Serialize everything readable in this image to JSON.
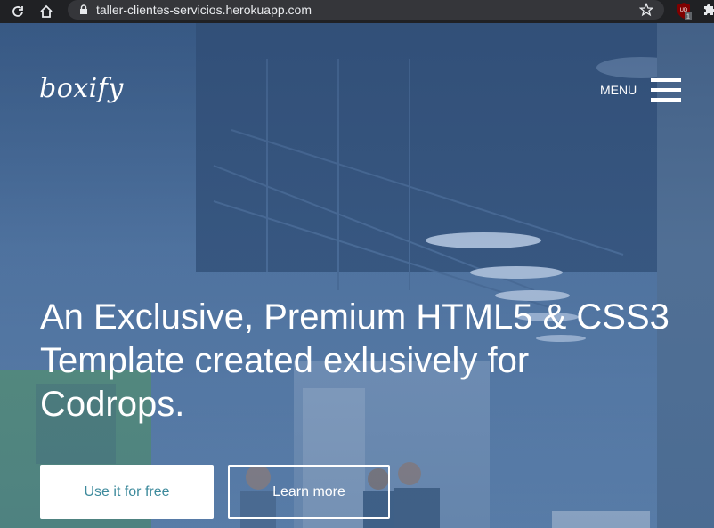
{
  "browser": {
    "url": "taller-clientes-servicios.herokuapp.com",
    "ext_badge": "1",
    "ext_label": "UD"
  },
  "header": {
    "logo": "boxify",
    "menu_label": "MENU"
  },
  "hero": {
    "headline": "An Exclusive, Premium HTML5 & CSS3 Template created exlusively for Codrops.",
    "primary_button": "Use it for free",
    "secondary_button": "Learn more"
  },
  "icons": {
    "reload": "reload-icon",
    "home": "home-icon",
    "lock": "lock-icon",
    "star": "star-icon",
    "extension": "ublock-icon",
    "extensions_menu": "puzzle-icon",
    "menu": "hamburger-icon"
  },
  "colors": {
    "primary_button_text": "#3d8a9c",
    "overlay": "#345480"
  }
}
